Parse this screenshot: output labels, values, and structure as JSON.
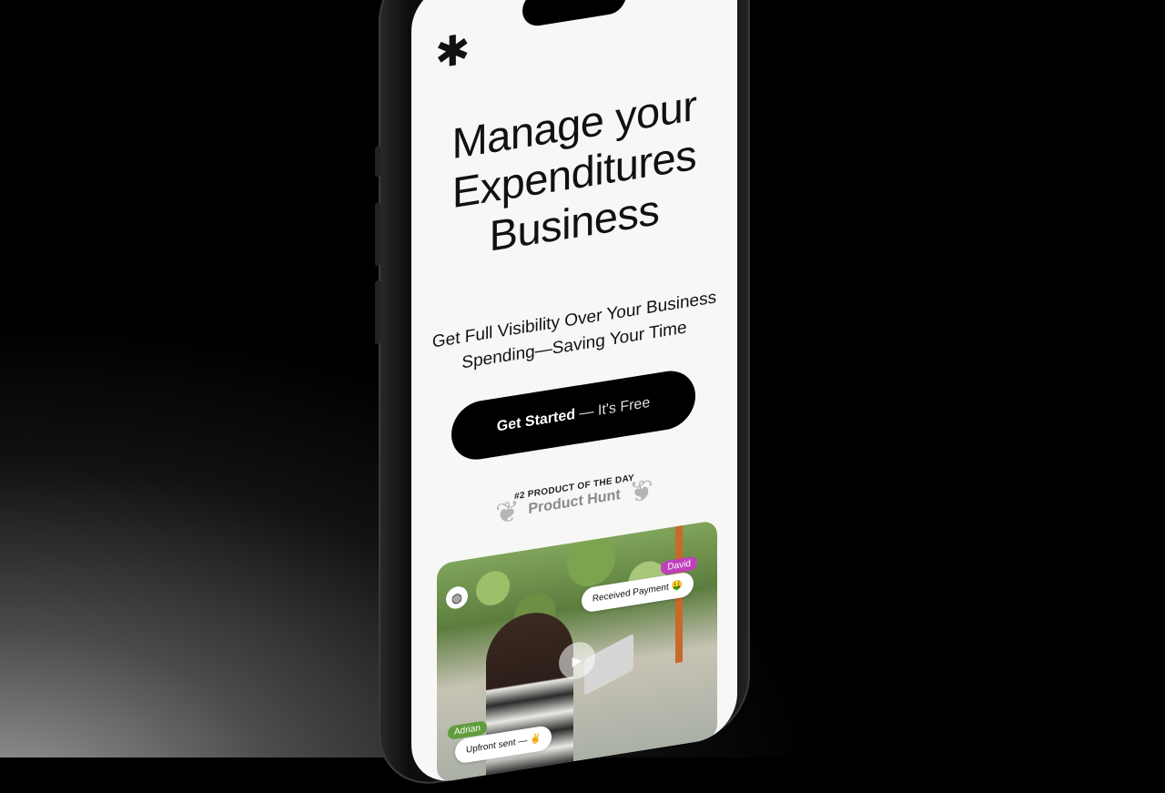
{
  "header": {
    "logo_glyph": "✱",
    "logo_name": "asterisk-logo"
  },
  "hero": {
    "headline_line1": "Manage your",
    "headline_line2": "Expenditures",
    "headline_line3": "Business",
    "subtitle_line1": "Get Full Visibility Over Your Business",
    "subtitle_line2": "Spending—Saving Your Time"
  },
  "cta": {
    "bold": "Get Started",
    "rest": " — It's Free"
  },
  "badge": {
    "rank": "#2 PRODUCT OF THE DAY",
    "name": "Product Hunt"
  },
  "video": {
    "tag_david": "David",
    "bubble_payment": "Received Payment 🤑",
    "tag_adrian": "Adrian",
    "bubble_upfront": "Upfront sent — ✌️"
  },
  "colors": {
    "accent_black": "#000000",
    "tag_david": "#c23fbc",
    "tag_adrian": "#5f9d3a"
  }
}
